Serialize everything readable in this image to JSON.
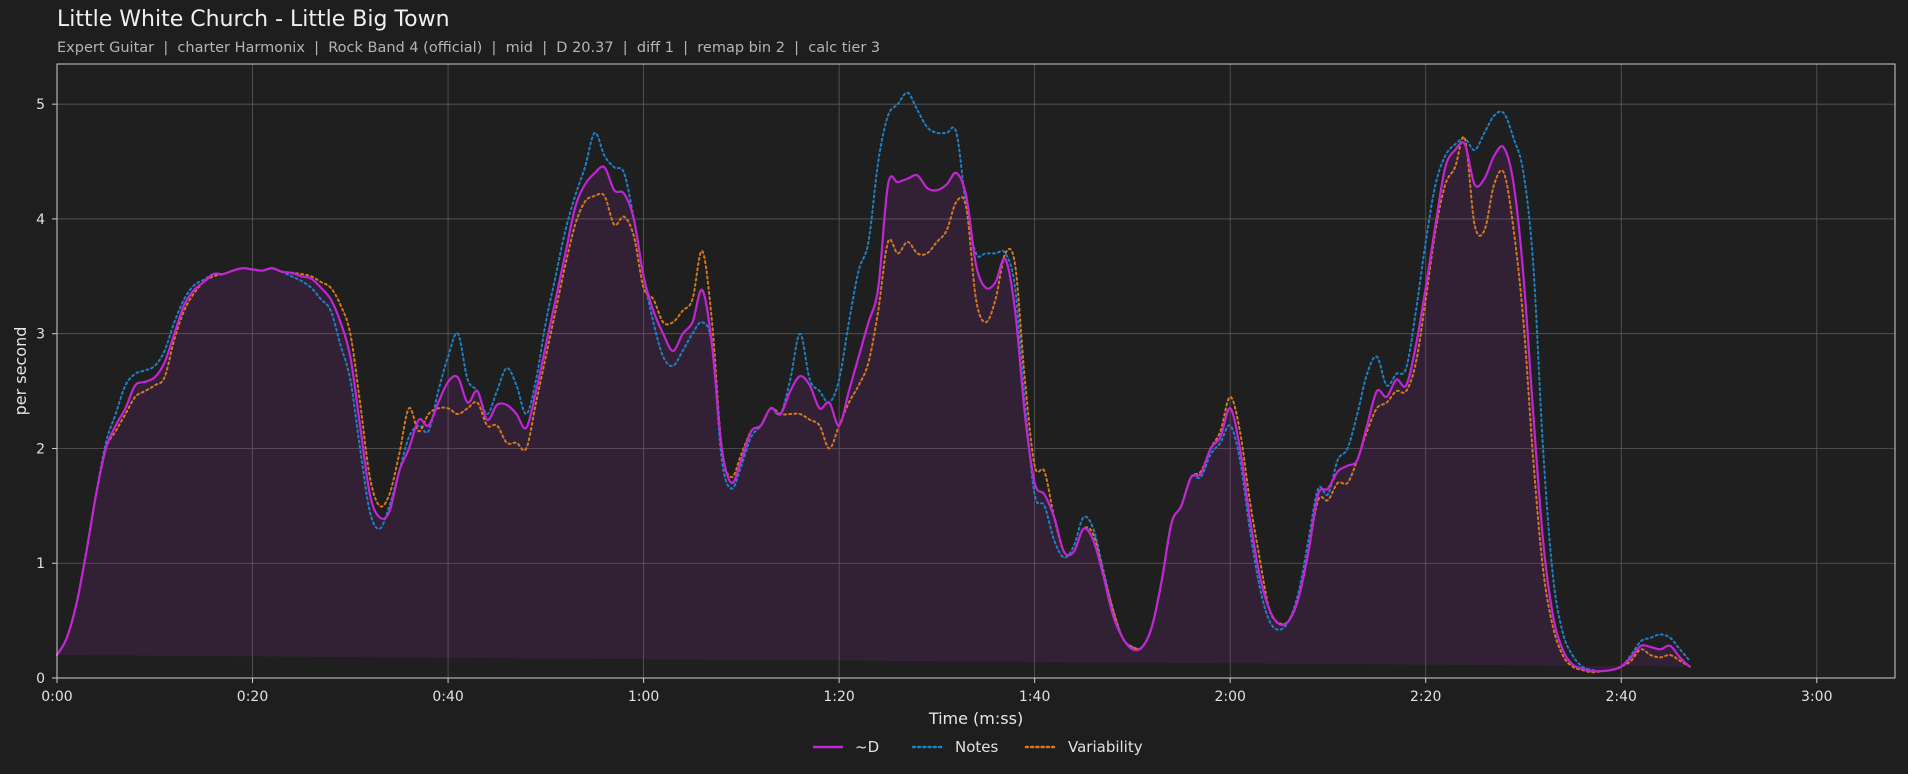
{
  "header": {
    "title": "Little White Church - Little Big Town",
    "subtitle": "Expert Guitar  |  charter Harmonix  |  Rock Band 4 (official)  |  mid  |  D 20.37  |  diff 1  |  remap bin 2  |  calc tier 3"
  },
  "chart_data": {
    "type": "line",
    "title": "Little White Church - Little Big Town",
    "subtitle": "Expert Guitar  |  charter Harmonix  |  Rock Band 4 (official)  |  mid  |  D 20.37  |  diff 1  |  remap bin 2  |  calc tier 3",
    "xlabel": "Time (m:ss)",
    "ylabel": "per second",
    "xlim": [
      0,
      188
    ],
    "ylim": [
      0,
      5.35
    ],
    "x_ticks": [
      0,
      20,
      40,
      60,
      80,
      100,
      120,
      140,
      160,
      180
    ],
    "x_tick_labels": [
      "0:00",
      "0:20",
      "0:40",
      "1:00",
      "1:20",
      "1:40",
      "2:00",
      "2:20",
      "2:40",
      "3:00"
    ],
    "y_ticks": [
      0,
      1,
      2,
      3,
      4,
      5
    ],
    "y_tick_labels": [
      "0",
      "1",
      "2",
      "3",
      "4",
      "5"
    ],
    "grid": true,
    "legend_position": "bottom-center",
    "x": [
      0,
      1,
      2,
      3,
      4,
      5,
      6,
      7,
      8,
      9,
      10,
      11,
      12,
      13,
      14,
      15,
      16,
      17,
      18,
      19,
      20,
      21,
      22,
      23,
      24,
      25,
      26,
      27,
      28,
      29,
      30,
      31,
      32,
      33,
      34,
      35,
      36,
      37,
      38,
      39,
      40,
      41,
      42,
      43,
      44,
      45,
      46,
      47,
      48,
      49,
      50,
      51,
      52,
      53,
      54,
      55,
      56,
      57,
      58,
      59,
      60,
      61,
      62,
      63,
      64,
      65,
      66,
      67,
      68,
      69,
      70,
      71,
      72,
      73,
      74,
      75,
      76,
      77,
      78,
      79,
      80,
      81,
      82,
      83,
      84,
      85,
      86,
      87,
      88,
      89,
      90,
      91,
      92,
      93,
      94,
      95,
      96,
      97,
      98,
      99,
      100,
      101,
      102,
      103,
      104,
      105,
      106,
      107,
      108,
      109,
      110,
      111,
      112,
      113,
      114,
      115,
      116,
      117,
      118,
      119,
      120,
      121,
      122,
      123,
      124,
      125,
      126,
      127,
      128,
      129,
      130,
      131,
      132,
      133,
      134,
      135,
      136,
      137,
      138,
      139,
      140,
      141,
      142,
      143,
      144,
      145,
      146,
      147,
      148,
      149,
      150,
      151,
      152,
      153,
      154,
      155,
      156,
      157,
      158,
      159,
      160,
      161,
      162,
      163,
      164,
      165,
      166,
      167,
      168,
      169,
      170,
      171,
      172,
      173,
      174,
      175,
      176,
      177,
      178,
      179,
      180,
      181,
      182,
      183,
      184,
      185,
      186,
      187,
      188
    ],
    "series": [
      {
        "name": "~D",
        "color": "#c026d3",
        "style": "solid",
        "fill": true,
        "values": [
          0.2,
          0.35,
          0.65,
          1.1,
          1.6,
          2.0,
          2.2,
          2.35,
          2.55,
          2.58,
          2.62,
          2.75,
          3.0,
          3.25,
          3.38,
          3.45,
          3.52,
          3.52,
          3.55,
          3.57,
          3.56,
          3.55,
          3.57,
          3.54,
          3.53,
          3.5,
          3.48,
          3.4,
          3.3,
          3.1,
          2.8,
          2.2,
          1.6,
          1.4,
          1.45,
          1.8,
          2.0,
          2.25,
          2.2,
          2.4,
          2.58,
          2.62,
          2.4,
          2.5,
          2.25,
          2.38,
          2.38,
          2.3,
          2.18,
          2.5,
          2.9,
          3.3,
          3.7,
          4.1,
          4.3,
          4.4,
          4.45,
          4.25,
          4.22,
          4.0,
          3.5,
          3.2,
          3.0,
          2.85,
          3.0,
          3.1,
          3.38,
          2.9,
          2.0,
          1.7,
          1.9,
          2.15,
          2.2,
          2.35,
          2.3,
          2.5,
          2.63,
          2.55,
          2.35,
          2.4,
          2.2,
          2.5,
          2.8,
          3.1,
          3.4,
          4.3,
          4.32,
          4.35,
          4.38,
          4.27,
          4.25,
          4.3,
          4.4,
          4.2,
          3.6,
          3.4,
          3.45,
          3.65,
          3.2,
          2.3,
          1.7,
          1.6,
          1.4,
          1.1,
          1.1,
          1.3,
          1.2,
          0.9,
          0.55,
          0.35,
          0.25,
          0.27,
          0.45,
          0.85,
          1.35,
          1.5,
          1.75,
          1.78,
          2.0,
          2.1,
          2.35,
          2.0,
          1.4,
          0.9,
          0.6,
          0.47,
          0.5,
          0.7,
          1.1,
          1.6,
          1.65,
          1.8,
          1.85,
          1.9,
          2.2,
          2.5,
          2.45,
          2.6,
          2.55,
          2.9,
          3.4,
          3.95,
          4.45,
          4.6,
          4.65,
          4.3,
          4.35,
          4.55,
          4.62,
          4.3,
          3.5,
          2.3,
          1.2,
          0.55,
          0.25,
          0.12,
          0.08,
          0.06,
          0.06,
          0.07,
          0.1,
          0.18,
          0.28,
          0.27,
          0.25,
          0.28,
          0.18,
          0.1,
          0.05
        ]
      },
      {
        "name": "Notes",
        "color": "#1f7fc4",
        "style": "dotted",
        "values": [
          0.2,
          0.35,
          0.65,
          1.1,
          1.6,
          2.05,
          2.3,
          2.55,
          2.65,
          2.68,
          2.72,
          2.85,
          3.1,
          3.3,
          3.42,
          3.47,
          3.52,
          3.52,
          3.55,
          3.57,
          3.56,
          3.55,
          3.57,
          3.54,
          3.5,
          3.46,
          3.4,
          3.3,
          3.2,
          2.9,
          2.6,
          2.0,
          1.45,
          1.3,
          1.5,
          1.8,
          2.1,
          2.2,
          2.15,
          2.5,
          2.8,
          3.0,
          2.6,
          2.5,
          2.3,
          2.5,
          2.7,
          2.55,
          2.3,
          2.6,
          3.1,
          3.5,
          3.9,
          4.2,
          4.45,
          4.75,
          4.55,
          4.45,
          4.4,
          4.0,
          3.5,
          3.1,
          2.8,
          2.72,
          2.85,
          3.0,
          3.1,
          2.9,
          1.9,
          1.65,
          1.85,
          2.1,
          2.2,
          2.35,
          2.3,
          2.6,
          3.0,
          2.6,
          2.5,
          2.4,
          2.6,
          3.1,
          3.55,
          3.8,
          4.5,
          4.9,
          5.0,
          5.1,
          4.95,
          4.8,
          4.75,
          4.75,
          4.75,
          4.1,
          3.7,
          3.7,
          3.7,
          3.7,
          3.4,
          2.4,
          1.6,
          1.5,
          1.2,
          1.05,
          1.15,
          1.4,
          1.3,
          0.95,
          0.6,
          0.35,
          0.27,
          0.27,
          0.45,
          0.85,
          1.35,
          1.5,
          1.75,
          1.75,
          1.95,
          2.05,
          2.2,
          1.9,
          1.3,
          0.8,
          0.5,
          0.42,
          0.5,
          0.75,
          1.2,
          1.65,
          1.6,
          1.9,
          2.0,
          2.3,
          2.65,
          2.8,
          2.55,
          2.65,
          2.7,
          3.2,
          3.8,
          4.3,
          4.55,
          4.65,
          4.7,
          4.6,
          4.75,
          4.9,
          4.92,
          4.7,
          4.4,
          3.6,
          2.0,
          0.9,
          0.4,
          0.2,
          0.1,
          0.07,
          0.06,
          0.07,
          0.1,
          0.2,
          0.32,
          0.35,
          0.38,
          0.35,
          0.25,
          0.15,
          0.05
        ]
      },
      {
        "name": "Variability",
        "color": "#d2781e",
        "style": "dotted",
        "values": [
          0.2,
          0.35,
          0.65,
          1.1,
          1.6,
          2.0,
          2.15,
          2.3,
          2.45,
          2.5,
          2.55,
          2.62,
          2.95,
          3.2,
          3.35,
          3.45,
          3.5,
          3.52,
          3.55,
          3.57,
          3.56,
          3.55,
          3.57,
          3.54,
          3.53,
          3.52,
          3.5,
          3.45,
          3.4,
          3.25,
          3.0,
          2.4,
          1.75,
          1.5,
          1.6,
          1.95,
          2.35,
          2.15,
          2.3,
          2.35,
          2.35,
          2.3,
          2.35,
          2.4,
          2.2,
          2.2,
          2.05,
          2.05,
          2.0,
          2.4,
          2.8,
          3.2,
          3.6,
          3.95,
          4.15,
          4.2,
          4.2,
          3.95,
          4.02,
          3.85,
          3.4,
          3.3,
          3.1,
          3.1,
          3.2,
          3.3,
          3.72,
          3.1,
          2.0,
          1.75,
          1.95,
          2.15,
          2.2,
          2.35,
          2.3,
          2.3,
          2.3,
          2.25,
          2.2,
          2.0,
          2.2,
          2.4,
          2.55,
          2.75,
          3.2,
          3.8,
          3.7,
          3.8,
          3.7,
          3.7,
          3.8,
          3.9,
          4.15,
          4.1,
          3.3,
          3.1,
          3.3,
          3.7,
          3.6,
          2.6,
          1.85,
          1.8,
          1.4,
          1.1,
          1.1,
          1.3,
          1.25,
          0.92,
          0.6,
          0.35,
          0.27,
          0.27,
          0.45,
          0.85,
          1.35,
          1.5,
          1.75,
          1.8,
          2.0,
          2.15,
          2.45,
          2.15,
          1.55,
          1.05,
          0.6,
          0.48,
          0.5,
          0.7,
          1.1,
          1.55,
          1.55,
          1.7,
          1.7,
          1.9,
          2.15,
          2.35,
          2.4,
          2.5,
          2.5,
          2.75,
          3.3,
          3.9,
          4.3,
          4.45,
          4.7,
          3.95,
          3.9,
          4.3,
          4.4,
          3.9,
          3.1,
          1.9,
          0.95,
          0.45,
          0.2,
          0.1,
          0.07,
          0.05,
          0.06,
          0.07,
          0.1,
          0.15,
          0.25,
          0.2,
          0.18,
          0.2,
          0.15,
          0.1,
          0.05
        ]
      }
    ]
  }
}
